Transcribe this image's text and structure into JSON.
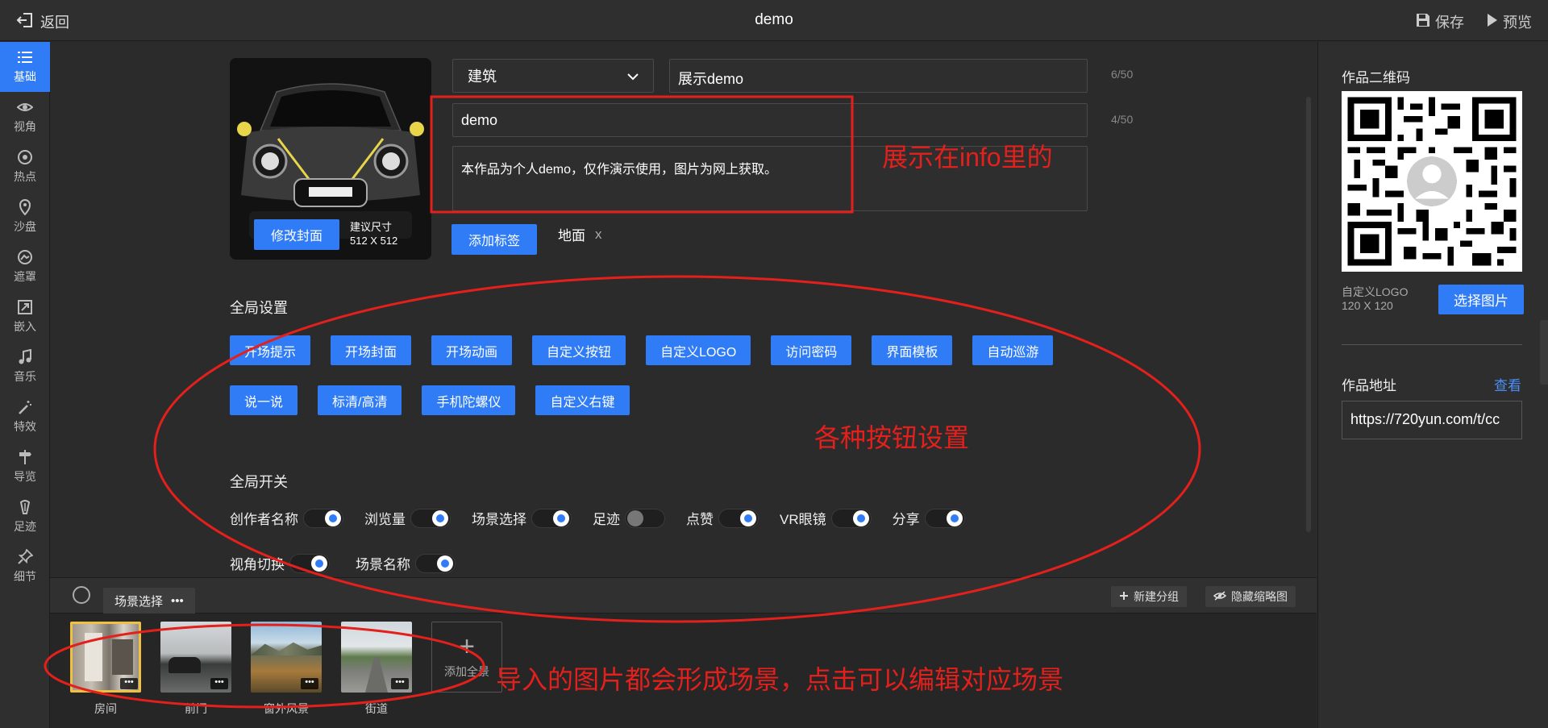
{
  "topbar": {
    "back_label": "返回",
    "title": "demo",
    "save_label": "保存",
    "preview_label": "预览"
  },
  "sidebar": {
    "items": [
      {
        "label": "基础",
        "icon": "list-icon",
        "active": true
      },
      {
        "label": "视角",
        "icon": "eye-icon"
      },
      {
        "label": "热点",
        "icon": "target-icon"
      },
      {
        "label": "沙盘",
        "icon": "pin-icon"
      },
      {
        "label": "遮罩",
        "icon": "mask-icon"
      },
      {
        "label": "嵌入",
        "icon": "embed-icon"
      },
      {
        "label": "音乐",
        "icon": "music-icon"
      },
      {
        "label": "特效",
        "icon": "magic-wand-icon"
      },
      {
        "label": "导览",
        "icon": "signpost-icon"
      },
      {
        "label": "足迹",
        "icon": "footprint-icon"
      },
      {
        "label": "细节",
        "icon": "thumbtack-icon"
      }
    ]
  },
  "cover": {
    "edit_label": "修改封面",
    "hint_line1": "建议尺寸",
    "hint_line2": "512 X 512"
  },
  "form": {
    "category": "建筑",
    "title_value": "展示demo",
    "title_counter": "6/50",
    "name_value": "demo",
    "name_counter": "4/50",
    "description": "本作品为个人demo，仅作演示使用，图片为网上获取。",
    "add_tag_label": "添加标签",
    "tag_text": "地面",
    "tag_remove": "x"
  },
  "global_settings": {
    "title": "全局设置",
    "row1": [
      "开场提示",
      "开场封面",
      "开场动画",
      "自定义按钮",
      "自定义LOGO",
      "访问密码",
      "界面模板",
      "自动巡游"
    ],
    "row2": [
      "说一说",
      "标清/高清",
      "手机陀螺仪",
      "自定义右键"
    ]
  },
  "global_switches": {
    "title": "全局开关",
    "row1": [
      {
        "label": "创作者名称",
        "on": true
      },
      {
        "label": "浏览量",
        "on": true
      },
      {
        "label": "场景选择",
        "on": true
      },
      {
        "label": "足迹",
        "on": false
      },
      {
        "label": "点赞",
        "on": true
      },
      {
        "label": "VR眼镜",
        "on": true
      },
      {
        "label": "分享",
        "on": true
      }
    ],
    "row2": [
      {
        "label": "视角切换",
        "on": true
      },
      {
        "label": "场景名称",
        "on": true
      }
    ]
  },
  "right_panel": {
    "qr_title": "作品二维码",
    "logo_hint_line1": "自定义LOGO",
    "logo_hint_line2": "120 X 120",
    "pick_image_label": "选择图片",
    "address_title": "作品地址",
    "view_link": "查看",
    "address_value": "https://720yun.com/t/cc"
  },
  "scene_strip": {
    "group_tab": "场景选择",
    "group_more": "•••",
    "new_group_label": "新建分组",
    "hide_thumbs_label": "隐藏缩略图",
    "scenes": [
      {
        "label": "房间",
        "selected": true
      },
      {
        "label": "前门"
      },
      {
        "label": "窗外风景"
      },
      {
        "label": "街道"
      }
    ],
    "add_panorama_label": "添加全景"
  },
  "annotations": {
    "info_note": "展示在info里的",
    "buttons_note": "各种按钮设置",
    "scenes_note": "导入的图片都会形成场景，点击可以编辑对应场景"
  },
  "colors": {
    "accent": "#2f7cf6",
    "annotation": "#e3201c",
    "background": "#2b2b2b"
  }
}
